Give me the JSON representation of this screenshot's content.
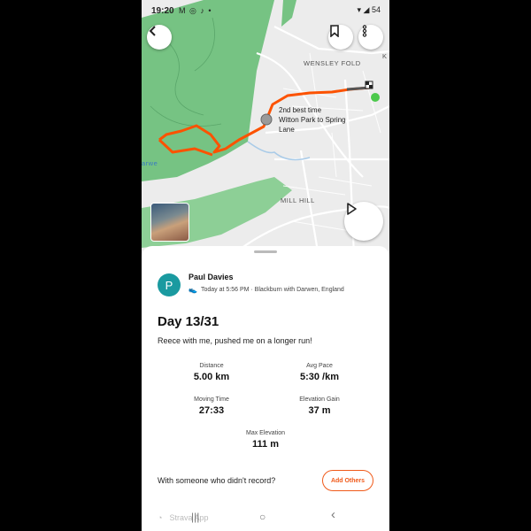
{
  "status_bar": {
    "time": "19:20",
    "notif_icons": "M ◎ ♪ •",
    "battery": "54"
  },
  "map": {
    "labels": {
      "wensley_fold": "WENSLEY FOLD",
      "mill_hill": "MILL HILL",
      "k_edge": "K",
      "arwen_edge": "arwe"
    },
    "segment": {
      "line1": "2nd best time",
      "line2": "Witton Park to Spring",
      "line3": "Lane"
    },
    "route_color": "#fc5200",
    "park_color": "#6cc07a"
  },
  "activity": {
    "athlete_initial": "P",
    "athlete_name": "Paul Davies",
    "meta": "Today at 5:56 PM · Blackburn with Darwen, England",
    "title": "Day 13/31",
    "description": "Reece with me, pushed me on a longer run!",
    "stats": [
      {
        "label": "Distance",
        "value": "5.00 km"
      },
      {
        "label": "Avg Pace",
        "value": "5:30 /km"
      },
      {
        "label": "Moving Time",
        "value": "27:33"
      },
      {
        "label": "Elevation Gain",
        "value": "37 m"
      },
      {
        "label": "Max Elevation",
        "value": "111 m"
      }
    ],
    "with_text": "With someone who didn't record?",
    "add_others": "Add Others"
  },
  "bottom": {
    "app_label": "Strava App",
    "recents": "|||",
    "home": "○",
    "back": "‹"
  },
  "colors": {
    "accent": "#f05a1a",
    "avatar": "#1a9aa0"
  }
}
